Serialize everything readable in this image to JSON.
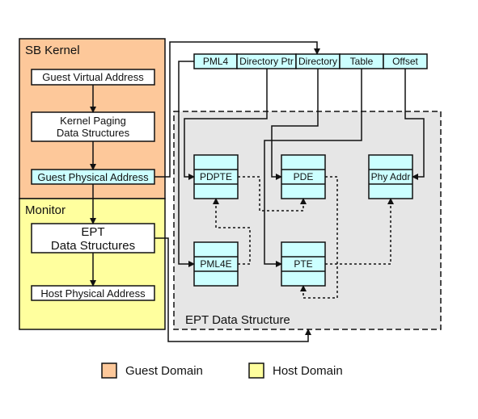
{
  "colors": {
    "guest": "#fdc89a",
    "host": "#ffff9e",
    "entry": "#ccffff",
    "ept_region": "#e6e6e6"
  },
  "sb_kernel": {
    "title": "SB Kernel",
    "gva": "Guest Virtual Address",
    "kp1": "Kernel Paging",
    "kp2": "Data Structures",
    "gpa": "Guest Physical Address"
  },
  "monitor": {
    "title": "Monitor",
    "ept1": "EPT",
    "ept2": "Data Structures",
    "hpa": "Host Physical Address"
  },
  "address_fields": [
    "PML4",
    "Directory Ptr",
    "Directory",
    "Table",
    "Offset"
  ],
  "ept": {
    "title": "EPT Data Structure",
    "pdpte": "PDPTE",
    "pde": "PDE",
    "phy": "Phy Addr",
    "pml4e": "PML4E",
    "pte": "PTE"
  },
  "legend": {
    "guest": "Guest Domain",
    "host": "Host Domain"
  }
}
